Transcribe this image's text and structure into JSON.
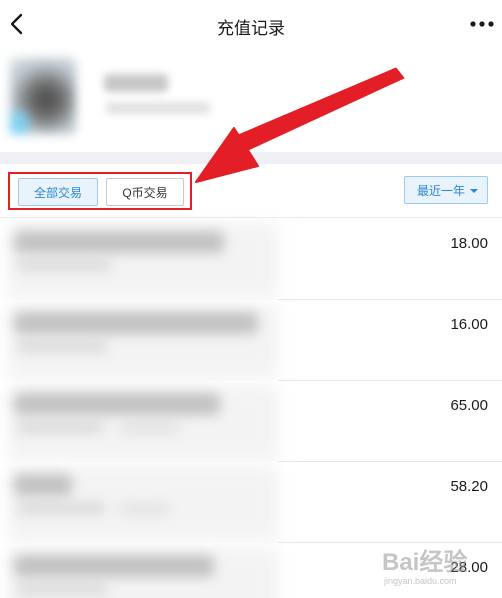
{
  "header": {
    "title": "充值记录",
    "back_icon": "chevron-left-icon",
    "more_icon": "more-dots-icon"
  },
  "filters": {
    "tabs": [
      {
        "label": "全部交易",
        "selected": true
      },
      {
        "label": "Q币交易",
        "selected": false
      }
    ],
    "period": "最近一年"
  },
  "transactions": [
    {
      "amount": "18.00"
    },
    {
      "amount": "16.00"
    },
    {
      "amount": "65.00"
    },
    {
      "amount": "58.20"
    },
    {
      "amount": "28.00"
    }
  ],
  "annotation": {
    "arrow_color": "#e41e26",
    "box_color": "#e41e26"
  },
  "watermark": {
    "text": "Bai经验",
    "sub": "jingyan.baidu.com"
  },
  "colors": {
    "accent": "#2b86d6",
    "accent_bg": "#e8f3fc",
    "band": "#eef0f4"
  }
}
